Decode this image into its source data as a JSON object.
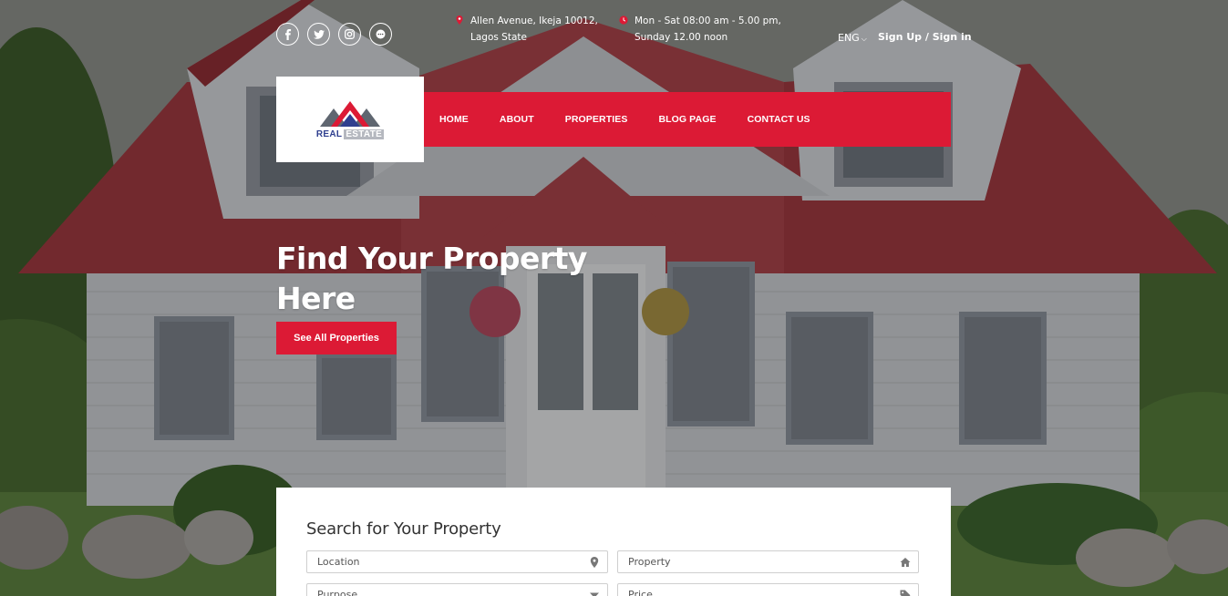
{
  "social": {
    "icons": [
      "facebook-icon",
      "twitter-icon",
      "instagram-icon",
      "chat-icon"
    ]
  },
  "contact": {
    "address_line1": "Allen Avenue, Ikeja 10012,",
    "address_line2": "Lagos State",
    "hours_line1": "Mon - Sat 08:00 am - 5.00 pm,",
    "hours_line2": "Sunday 12.00 noon",
    "accent_color": "#dc1a35"
  },
  "header": {
    "language": "ENG",
    "signin": "Sign Up / Sign in"
  },
  "logo": {
    "word1": "REAL",
    "word2": "ESTATE"
  },
  "nav": {
    "items": [
      "HOME",
      "ABOUT",
      "PROPERTIES",
      "BLOG PAGE",
      "CONTACT US"
    ],
    "background": "#dc1a35"
  },
  "hero": {
    "headline_line1": "Find Your Property",
    "headline_line2": "Here",
    "cta_label": "See All Properties"
  },
  "search": {
    "title": "Search for Your Property",
    "location_placeholder": "Location",
    "property_placeholder": "Property",
    "purpose_placeholder": "Purpose",
    "price_placeholder": "Price"
  }
}
